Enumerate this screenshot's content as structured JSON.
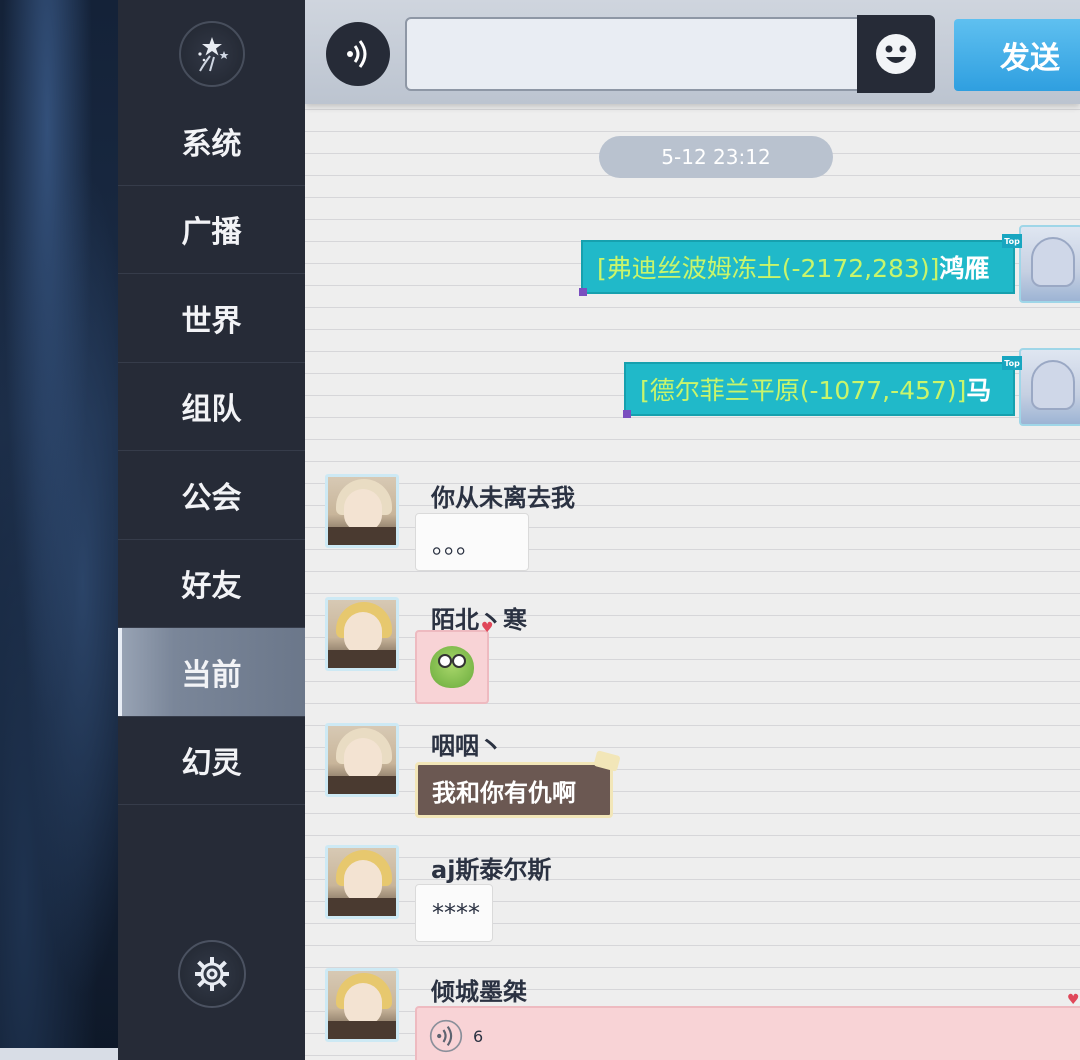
{
  "sidebar": {
    "logo_icon": "fireworks-icon",
    "items": [
      {
        "label": "系统"
      },
      {
        "label": "广播"
      },
      {
        "label": "世界"
      },
      {
        "label": "组队"
      },
      {
        "label": "公会"
      },
      {
        "label": "好友"
      },
      {
        "label": "当前",
        "active": true
      },
      {
        "label": "幻灵"
      }
    ],
    "settings_icon": "gear-icon"
  },
  "topbar": {
    "voice_icon": "voice-icon",
    "input_value": "",
    "emoji_icon": "smiley-face-icon",
    "send_label": "发送"
  },
  "chat": {
    "timestamp": "5-12 23:12",
    "outgoing": [
      {
        "location": "[弗迪丝波姆冻土(-2172,283)]",
        "text": "鸿雁",
        "badge": "Top"
      },
      {
        "location": "[德尔菲兰平原(-1077,-457)]",
        "text": "马",
        "badge": "Top"
      }
    ],
    "incoming": [
      {
        "sender": "你从未离去我",
        "text": "。。。",
        "bubble": "plain"
      },
      {
        "sender": "陌北丶寒",
        "text": "",
        "bubble": "sticker"
      },
      {
        "sender": "咽咽丶",
        "text": "我和你有仇啊",
        "bubble": "brown"
      },
      {
        "sender": "aj斯泰尔斯",
        "text": "****",
        "bubble": "plain"
      },
      {
        "sender": "倾城墨桀",
        "voice_seconds": "6",
        "bubble": "voice"
      }
    ]
  },
  "colors": {
    "sidebar_bg": "#262b37",
    "active_tab": "#7a8699",
    "outgoing_bubble": "#20b9c9",
    "location_text": "#c9f56b",
    "send_button": "#2f9fe0"
  }
}
